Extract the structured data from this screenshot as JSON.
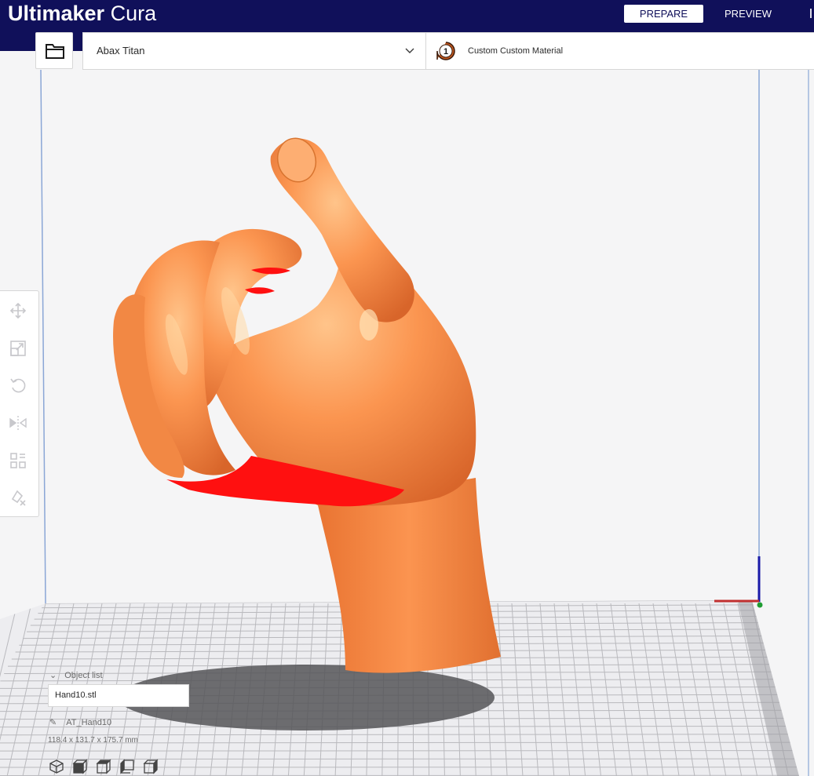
{
  "header": {
    "brand": "Ultimaker",
    "product": "Cura",
    "tabs": [
      {
        "label": "PREPARE",
        "active": true
      },
      {
        "label": "PREVIEW",
        "active": false
      }
    ],
    "bg_color": "#10105a"
  },
  "toolbar": {
    "open_icon": "folder-icon",
    "printer": {
      "name": "Abax Titan",
      "icon": "chevron-down-icon"
    },
    "material": {
      "extruder_number": "1",
      "name": "Custom Custom Material"
    }
  },
  "tools": [
    {
      "name": "move-tool",
      "icon": "move-icon"
    },
    {
      "name": "scale-tool",
      "icon": "scale-icon"
    },
    {
      "name": "rotate-tool",
      "icon": "rotate-icon"
    },
    {
      "name": "mirror-tool",
      "icon": "mirror-icon"
    },
    {
      "name": "per-model-settings-tool",
      "icon": "per-model-settings-icon"
    },
    {
      "name": "support-blocker-tool",
      "icon": "support-blocker-icon"
    }
  ],
  "object_list": {
    "header_label": "Object list",
    "selected_file": "Hand10.stl",
    "object_name": "AT_Hand10",
    "dimensions": "118.4 x 131.7 x 175.7 mm"
  },
  "view_buttons": [
    "3d-view",
    "front-view",
    "top-view",
    "left-view",
    "right-view"
  ],
  "colors": {
    "model": "#f98b45",
    "overhang": "#ff1010",
    "build_plate_grid": "#b9b9bd",
    "axis_x": "#c12f2f",
    "axis_y": "#1f9c32",
    "axis_z": "#1a1aa8"
  }
}
